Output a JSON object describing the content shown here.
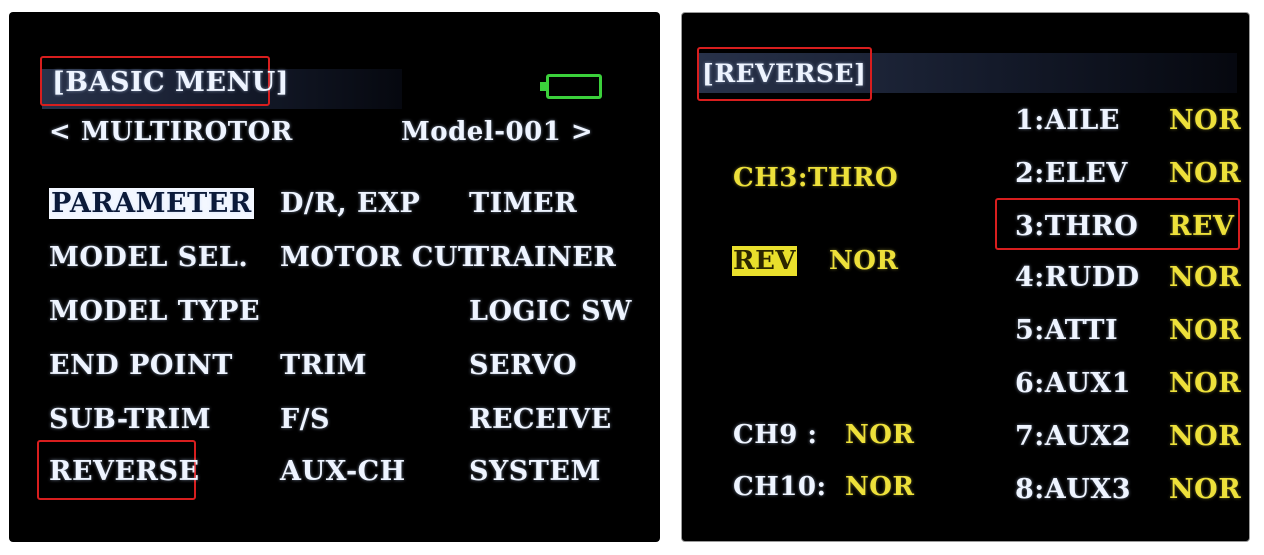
{
  "basic_menu": {
    "title": "[BASIC MENU]",
    "model_type_nav": "< MULTIROTOR",
    "model_name_nav": "Model-001 >",
    "items": [
      "PARAMETER",
      "D/R, EXP",
      "TIMER",
      "MODEL SEL.",
      "MOTOR CUT",
      "TRAINER",
      "MODEL TYPE",
      "LOGIC SW",
      "END POINT",
      "TRIM",
      "SERVO",
      "SUB-TRIM",
      "F/S",
      "RECEIVE",
      "REVERSE",
      "AUX-CH",
      "SYSTEM"
    ],
    "selected_item": "PARAMETER",
    "boxed_item": "REVERSE"
  },
  "reverse_menu": {
    "title": "[REVERSE]",
    "current_channel": "CH3:THRO",
    "option_rev": "REV",
    "option_nor": "NOR",
    "ch9_label": "CH9 :",
    "ch9_value": "NOR",
    "ch10_label": "CH10:",
    "ch10_value": "NOR",
    "channels": [
      {
        "name": "1:AILE",
        "value": "NOR"
      },
      {
        "name": "2:ELEV",
        "value": "NOR"
      },
      {
        "name": "3:THRO",
        "value": "REV"
      },
      {
        "name": "4:RUDD",
        "value": "NOR"
      },
      {
        "name": "5:ATTI",
        "value": "NOR"
      },
      {
        "name": "6:AUX1",
        "value": "NOR"
      },
      {
        "name": "7:AUX2",
        "value": "NOR"
      },
      {
        "name": "8:AUX3",
        "value": "NOR"
      }
    ]
  },
  "colors": {
    "screen_bg": "#000000",
    "text_white": "#eef4ff",
    "text_yellow": "#ede03a",
    "annotation_red": "#d81e1e",
    "battery_green": "#3bd03b"
  },
  "icons": [
    "battery-icon"
  ]
}
